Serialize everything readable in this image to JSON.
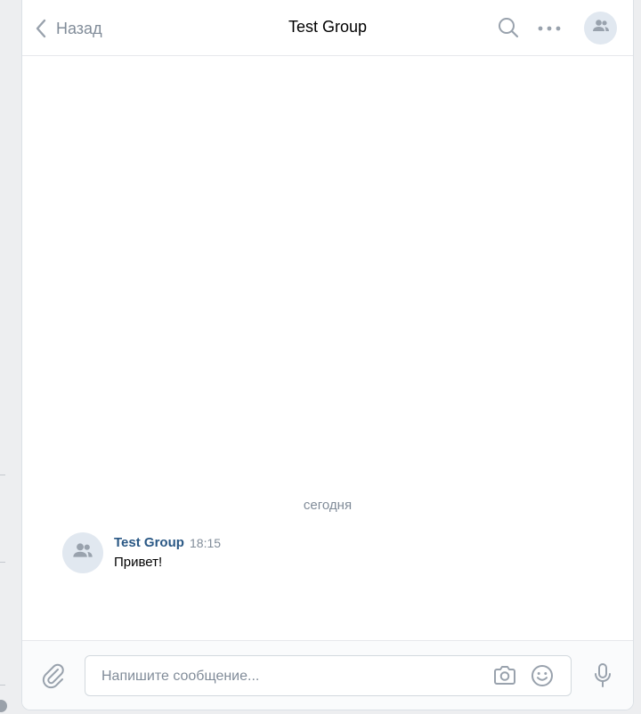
{
  "header": {
    "back_label": "Назад",
    "title": "Test Group",
    "icons": {
      "back": "chevron-left-icon",
      "search": "search-icon",
      "more": "more-horizontal-icon",
      "avatar": "group-avatar-icon"
    }
  },
  "messages": {
    "date_separator": "сегодня",
    "items": [
      {
        "author": "Test Group",
        "time": "18:15",
        "text": "Привет!"
      }
    ]
  },
  "composer": {
    "placeholder": "Напишите сообщение...",
    "value": "",
    "icons": {
      "attach": "paperclip-icon",
      "camera": "camera-icon",
      "emoji": "emoji-icon",
      "mic": "microphone-icon"
    }
  },
  "colors": {
    "accent": "#2a5885",
    "secondary_text": "#818c99",
    "icon": "#99a2ad",
    "avatar_bg": "#e1e8f0",
    "page_bg": "#edeef0"
  }
}
